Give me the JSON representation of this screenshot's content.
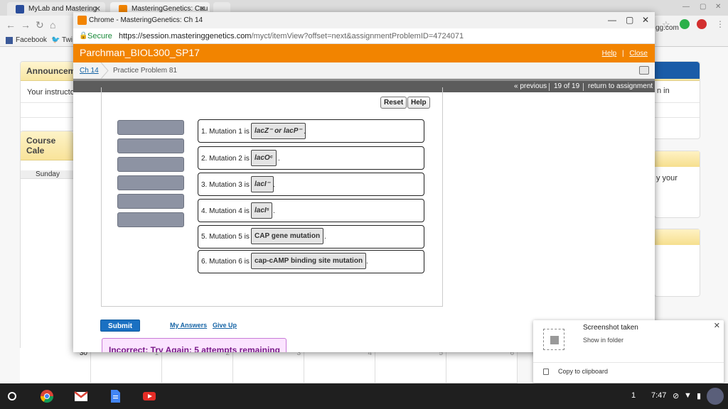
{
  "bg": {
    "tabs": [
      "MyLab and Mastering",
      "MasteringGenetics: Cou"
    ],
    "bookmarks": [
      "Facebook",
      "Twi"
    ],
    "url_suffix": "gg.com",
    "announcements_title": "Announcem",
    "instructor_text": "Your instructor",
    "right_text_in": "n in",
    "calendar_title": "Course Cale",
    "day_header": "Sunday",
    "right_text_your": "y your",
    "cal_numbers": [
      "30",
      "1",
      "2",
      "3",
      "4",
      "5",
      "6"
    ]
  },
  "popup": {
    "title": "Chrome - MasteringGenetics: Ch 14",
    "secure": "Secure",
    "url_host": "https://session.masteringgenetics.com",
    "url_path": "/myct/itemView?offset=next&assignmentProblemID=4724071",
    "course": "Parchman_BIOL300_SP17",
    "help": "Help",
    "close": "Close",
    "crumb_chapter": "Ch 14",
    "crumb_problem": "Practice Problem 81",
    "nav_previous": "« previous",
    "nav_position": "19 of 19",
    "nav_return": "return to assignment"
  },
  "problem": {
    "reset": "Reset",
    "help": "Help",
    "rows": [
      {
        "label": "1. Mutation 1 is",
        "answer": "lacZ⁻ or lacP⁻",
        "italic": true
      },
      {
        "label": "2. Mutation 2 is",
        "answer": "lacOᶜ",
        "italic": true
      },
      {
        "label": "3. Mutation 3 is",
        "answer": "lacI⁻",
        "italic": true
      },
      {
        "label": "4. Mutation 4 is",
        "answer": "lacIˢ",
        "italic": true
      },
      {
        "label": "5. Mutation 5 is",
        "answer": "CAP gene mutation",
        "italic": false
      },
      {
        "label": "6. Mutation 6 is",
        "answer": "cap-cAMP binding site mutation",
        "italic": false
      }
    ],
    "submit": "Submit",
    "my_answers": "My Answers",
    "give_up": "Give Up",
    "feedback": "Incorrect; Try Again; 5 attempts remaining"
  },
  "notification": {
    "title": "Screenshot taken",
    "subtitle": "Show in folder",
    "copy": "Copy to clipboard"
  },
  "shelf": {
    "badge": "1",
    "time": "7:47"
  }
}
